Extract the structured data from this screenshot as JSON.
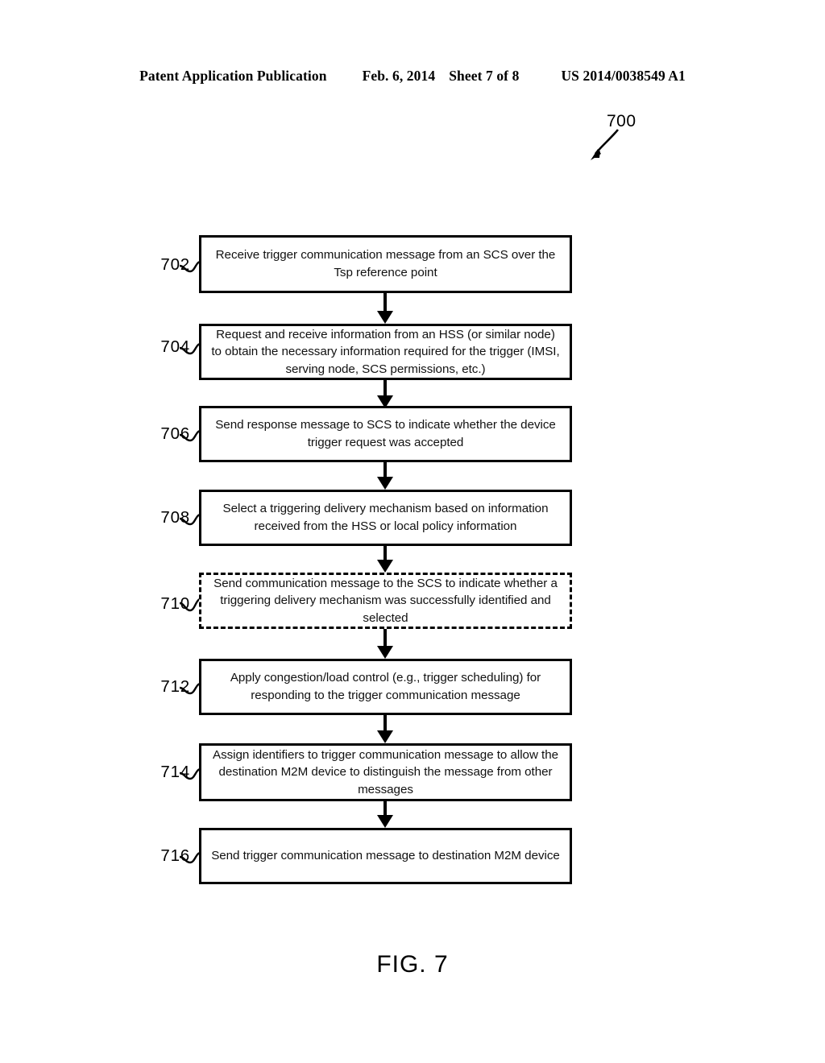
{
  "header": {
    "publication": "Patent Application Publication",
    "date": "Feb. 6, 2014",
    "sheet": "Sheet 7 of 8",
    "patent_number": "US 2014/0038549 A1"
  },
  "figure": {
    "reference_label": "700",
    "caption": "FIG. 7"
  },
  "flow": {
    "steps": [
      {
        "id": "702",
        "text": "Receive trigger communication message from an SCS over the Tsp reference point",
        "style": "solid"
      },
      {
        "id": "704",
        "text": "Request and receive information from an HSS (or similar node) to obtain the necessary information required for the trigger (IMSI, serving node, SCS permissions, etc.)",
        "style": "solid"
      },
      {
        "id": "706",
        "text": "Send response message to SCS to indicate whether the device trigger request was accepted",
        "style": "solid"
      },
      {
        "id": "708",
        "text": "Select a triggering delivery mechanism based on information received from the HSS or local policy information",
        "style": "solid"
      },
      {
        "id": "710",
        "text": "Send communication message to the SCS to indicate whether a triggering delivery mechanism was successfully identified and selected",
        "style": "dashed"
      },
      {
        "id": "712",
        "text": "Apply congestion/load control (e.g., trigger scheduling) for responding to the trigger communication message",
        "style": "solid"
      },
      {
        "id": "714",
        "text": "Assign identifiers to trigger communication message to allow the destination M2M device to distinguish the message from other messages",
        "style": "solid"
      },
      {
        "id": "716",
        "text": "Send trigger communication message to destination M2M device",
        "style": "solid"
      }
    ]
  }
}
